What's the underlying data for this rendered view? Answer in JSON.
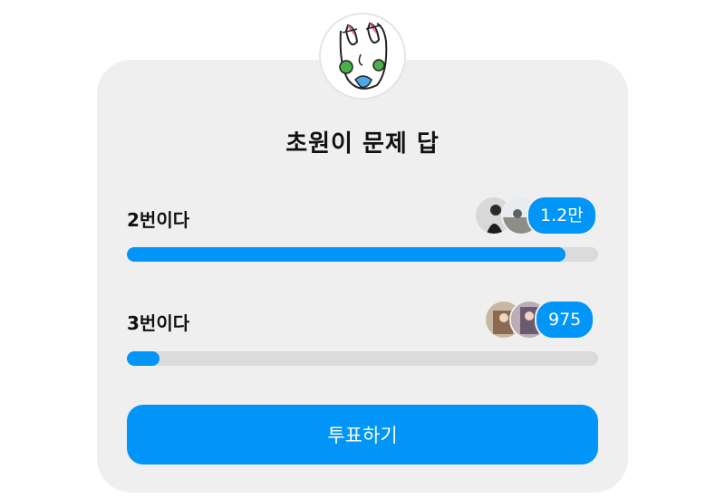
{
  "poll": {
    "title": "초원이 문제 답",
    "options": [
      {
        "label": "2번이다",
        "count": "1.2만",
        "fill_fraction": 0.93
      },
      {
        "label": "3번이다",
        "count": "975",
        "fill_fraction": 0.07
      }
    ],
    "vote_button_label": "투표하기"
  },
  "icons": {
    "author_avatar": "cartoon-face-avatar",
    "voter_avatars": "voter-avatar-icon"
  },
  "colors": {
    "accent": "#0095f6",
    "track": "#dbdbdb",
    "card": "#efefef"
  }
}
